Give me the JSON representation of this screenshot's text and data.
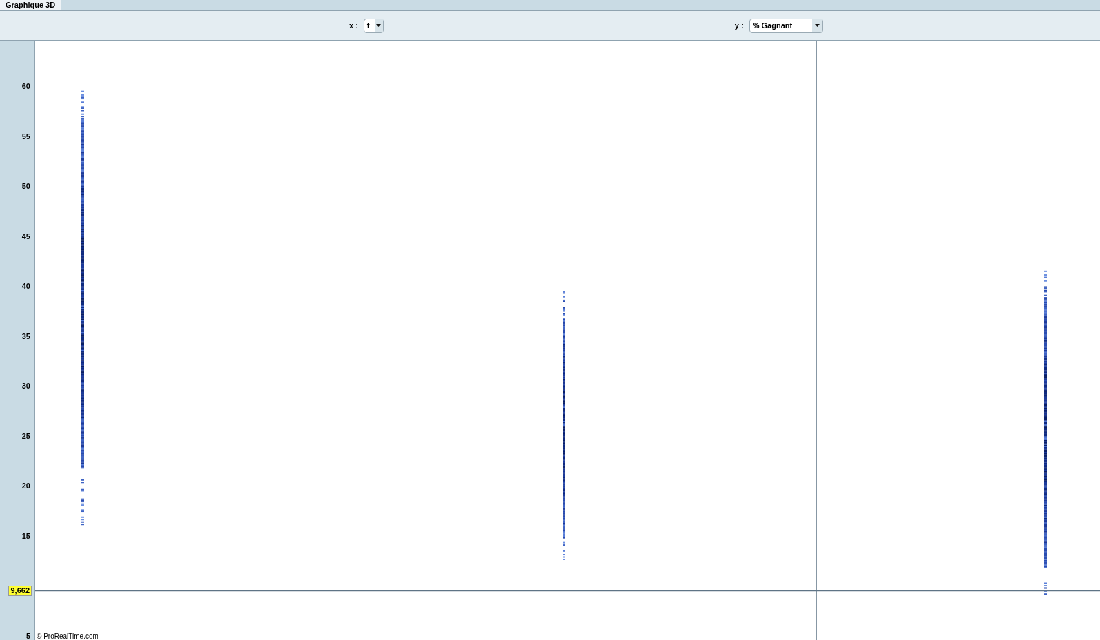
{
  "tabs": [
    {
      "label": "Graphique 3D",
      "selected": true
    }
  ],
  "x_selector": {
    "label": "x :",
    "value": "f"
  },
  "y_selector": {
    "label": "y :",
    "value": "% Gagnant"
  },
  "y_axis": {
    "ticks": [
      "60",
      "55",
      "50",
      "45",
      "40",
      "35",
      "30",
      "25",
      "20",
      "15",
      "5"
    ]
  },
  "crosshair": {
    "label": "9,662"
  },
  "copyright": "© ProRealTime.com"
}
